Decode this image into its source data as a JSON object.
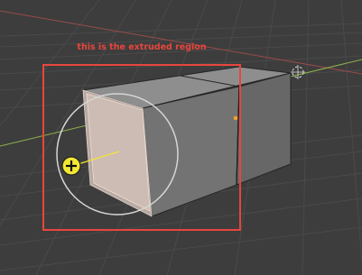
{
  "viewport": {
    "annotation": {
      "label": "this is the extruded region",
      "color": "#e8463c"
    },
    "colors": {
      "background": "#3d3d3d",
      "grid_line": "#4a4a4a",
      "x_axis": "#9a4b4b",
      "y_axis": "#8db24a",
      "cube_top": "#8e8e8e",
      "cube_front": "#737373",
      "cube_right": "#676767",
      "selected_face": "#cdbcb3",
      "selected_face_side": "#b9aaa1",
      "gizmo_circle": "#d6d6d6",
      "cursor_fill": "#f3e634",
      "origin_dot": "#f0a030"
    },
    "icons": {
      "cursor": "plus-circle-icon",
      "origin": "object-origin-icon",
      "world_cursor": "3d-cursor-icon"
    }
  }
}
